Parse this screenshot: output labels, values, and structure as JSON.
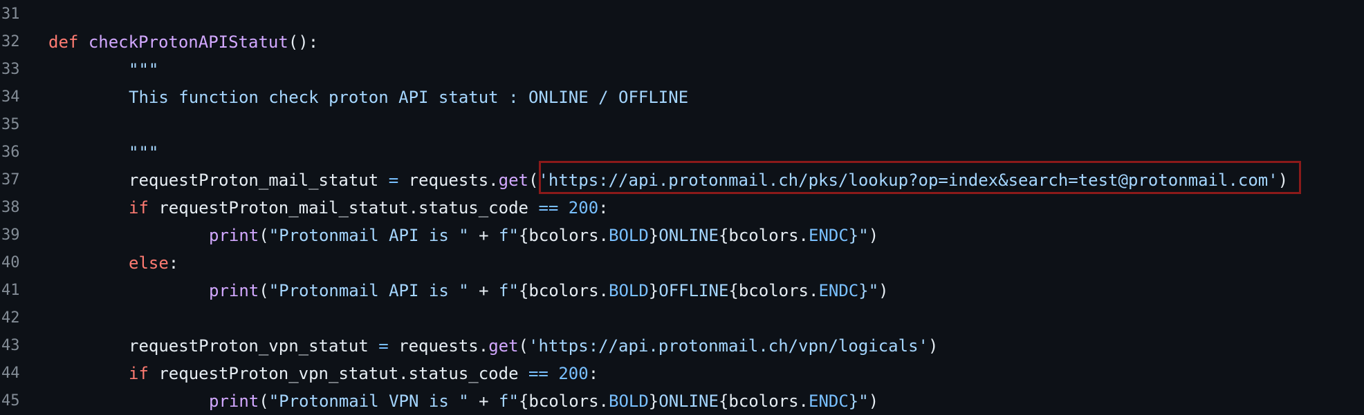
{
  "colors": {
    "background": "#0d1117",
    "line_number": "#848d97",
    "keyword": "#ff7b72",
    "function": "#d2a8ff",
    "string": "#a5d6ff",
    "number": "#79c0ff",
    "highlight_border": "#8b1a1a"
  },
  "lines": [
    {
      "n": "31"
    },
    {
      "n": "32",
      "t": {
        "def": "def",
        "fname": "checkProtonAPIStatut",
        "rest": "():"
      }
    },
    {
      "n": "33",
      "t": {
        "text": "\"\"\""
      }
    },
    {
      "n": "34",
      "t": {
        "text": "This function check proton API statut : ONLINE / OFFLINE"
      }
    },
    {
      "n": "35"
    },
    {
      "n": "36",
      "t": {
        "text": "\"\"\""
      }
    },
    {
      "n": "37",
      "t": {
        "var": "requestProton_mail_statut ",
        "eq": "=",
        "obj": " requests.",
        "call": "get",
        "open": "(",
        "url": "'https://api.protonmail.ch/pks/lookup?op=index&search=test@protonmail.com'",
        "close": ")"
      }
    },
    {
      "n": "38",
      "t": {
        "if": "if",
        "cond": " requestProton_mail_statut.status_code ",
        "op": "==",
        "num": " 200",
        "colon": ":"
      }
    },
    {
      "n": "39",
      "t": {
        "print": "print",
        "open": "(",
        "s1": "\"Protonmail API is \"",
        "plus": " + ",
        "f": "f\"",
        "b1": "{bcolors.",
        "bold": "BOLD",
        "b2": "}",
        "word": "ONLINE",
        "b3": "{bcolors.",
        "endc": "ENDC",
        "b4": "}\"",
        "close": ")"
      }
    },
    {
      "n": "40",
      "t": {
        "else": "else",
        "colon": ":"
      }
    },
    {
      "n": "41",
      "t": {
        "print": "print",
        "open": "(",
        "s1": "\"Protonmail API is \"",
        "plus": " + ",
        "f": "f\"",
        "b1": "{bcolors.",
        "bold": "BOLD",
        "b2": "}",
        "word": "OFFLINE",
        "b3": "{bcolors.",
        "endc": "ENDC",
        "b4": "}\"",
        "close": ")"
      }
    },
    {
      "n": "42"
    },
    {
      "n": "43",
      "t": {
        "var": "requestProton_vpn_statut ",
        "eq": "=",
        "obj": " requests.",
        "call": "get",
        "open": "(",
        "url": "'https://api.protonmail.ch/vpn/logicals'",
        "close": ")"
      }
    },
    {
      "n": "44",
      "t": {
        "if": "if",
        "cond": " requestProton_vpn_statut.status_code ",
        "op": "==",
        "num": " 200",
        "colon": ":"
      }
    },
    {
      "n": "45",
      "t": {
        "print": "print",
        "open": "(",
        "s1": "\"Protonmail VPN is \"",
        "plus": " + ",
        "f": "f\"",
        "b1": "{bcolors.",
        "bold": "BOLD",
        "b2": "}",
        "word": "ONLINE",
        "b3": "{bcolors.",
        "endc": "ENDC",
        "b4": "}\"",
        "close": ")"
      }
    }
  ]
}
